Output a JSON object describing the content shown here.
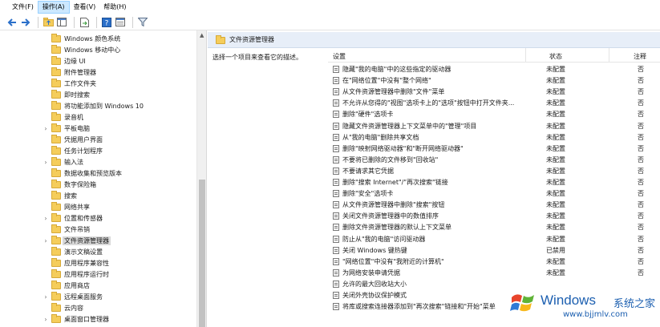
{
  "menu": {
    "items": [
      {
        "label": "文件(F)"
      },
      {
        "label": "操作(A)"
      },
      {
        "label": "查看(V)"
      },
      {
        "label": "帮助(H)"
      }
    ],
    "active_index": 1
  },
  "toolbar": {
    "buttons": [
      "back-arrow-icon",
      "forward-arrow-icon",
      "up-folder-icon",
      "show-hide-tree-icon",
      "export-list-icon",
      "help-icon",
      "properties-icon",
      "filter-icon"
    ]
  },
  "tree": {
    "items": [
      {
        "label": "Windows 颜色系统",
        "expander": false
      },
      {
        "label": "Windows 移动中心",
        "expander": false
      },
      {
        "label": "边缘 UI",
        "expander": false
      },
      {
        "label": "附件管理器",
        "expander": false
      },
      {
        "label": "工作文件夹",
        "expander": false
      },
      {
        "label": "即时搜索",
        "expander": false
      },
      {
        "label": "将功能添加到 Windows 10",
        "expander": false
      },
      {
        "label": "录音机",
        "expander": false
      },
      {
        "label": "平板电脑",
        "expander": true
      },
      {
        "label": "凭据用户界面",
        "expander": false
      },
      {
        "label": "任务计划程序",
        "expander": false
      },
      {
        "label": "输入法",
        "expander": true
      },
      {
        "label": "数据收集和预览版本",
        "expander": false
      },
      {
        "label": "数字保险箱",
        "expander": false
      },
      {
        "label": "搜索",
        "expander": false
      },
      {
        "label": "网络共享",
        "expander": false
      },
      {
        "label": "位置和传感器",
        "expander": true
      },
      {
        "label": "文件吊销",
        "expander": false
      },
      {
        "label": "文件资源管理器",
        "expander": true,
        "selected": true
      },
      {
        "label": "演示文稿设置",
        "expander": false
      },
      {
        "label": "应用程序兼容性",
        "expander": false
      },
      {
        "label": "应用程序运行时",
        "expander": false
      },
      {
        "label": "应用商店",
        "expander": false
      },
      {
        "label": "远程桌面服务",
        "expander": true
      },
      {
        "label": "云内容",
        "expander": false
      },
      {
        "label": "桌面窗口管理器",
        "expander": true
      }
    ]
  },
  "panel": {
    "title": "文件资源管理器",
    "description": "选择一个项目来查看它的描述。",
    "columns": {
      "setting": "设置",
      "state": "状态",
      "note": "注释"
    },
    "rows": [
      {
        "name": "隐藏\"我的电脑\"中的这些指定的驱动器",
        "state": "未配置",
        "note": "否"
      },
      {
        "name": "在\"网络位置\"中没有\"整个网络\"",
        "state": "未配置",
        "note": "否"
      },
      {
        "name": "从文件资源管理器中删除\"文件\"菜单",
        "state": "未配置",
        "note": "否"
      },
      {
        "name": "不允许从您得的\"视图\"选项卡上的\"选项\"按钮中打开文件夹...",
        "state": "未配置",
        "note": "否"
      },
      {
        "name": "删除\"硬件\"选项卡",
        "state": "未配置",
        "note": "否"
      },
      {
        "name": "隐藏文件资源管理器上下文菜单中的\"管理\"项目",
        "state": "未配置",
        "note": "否"
      },
      {
        "name": "从\"我的电脑\"删除共享文档",
        "state": "未配置",
        "note": "否"
      },
      {
        "name": "删除\"映射网络驱动器\"和\"断开网络驱动器\"",
        "state": "未配置",
        "note": "否"
      },
      {
        "name": "不要将已删除的文件移到\"回收站\"",
        "state": "未配置",
        "note": "否"
      },
      {
        "name": "不要请求其它凭据",
        "state": "未配置",
        "note": "否"
      },
      {
        "name": "删除\"搜索 Internet\"/\"再次搜索\"链接",
        "state": "未配置",
        "note": "否"
      },
      {
        "name": "删除\"安全\"选项卡",
        "state": "未配置",
        "note": "否"
      },
      {
        "name": "从文件资源管理器中删除\"搜索\"按钮",
        "state": "未配置",
        "note": "否"
      },
      {
        "name": "关闭文件资源管理器中的数值排序",
        "state": "未配置",
        "note": "否"
      },
      {
        "name": "删除文件资源管理器的默认上下文菜单",
        "state": "未配置",
        "note": "否"
      },
      {
        "name": "防止从\"我的电脑\"访问驱动器",
        "state": "未配置",
        "note": "否"
      },
      {
        "name": "关闭 Windows 键热键",
        "state": "已禁用",
        "note": "否"
      },
      {
        "name": "\"网络位置\"中没有\"我附近的计算机\"",
        "state": "未配置",
        "note": "否"
      },
      {
        "name": "为网络安装申请凭据",
        "state": "未配置",
        "note": "否"
      },
      {
        "name": "允许的最大回收站大小",
        "state": "",
        "note": ""
      },
      {
        "name": "关闭外壳协议保护模式",
        "state": "",
        "note": ""
      },
      {
        "name": "将库或搜索连接器添加到\"再次搜索\"链接和\"开始\"菜单",
        "state": "",
        "note": ""
      }
    ]
  },
  "watermark": {
    "brand": "Windows",
    "site": "系统之家",
    "url": "www.bjjmlv.com"
  }
}
